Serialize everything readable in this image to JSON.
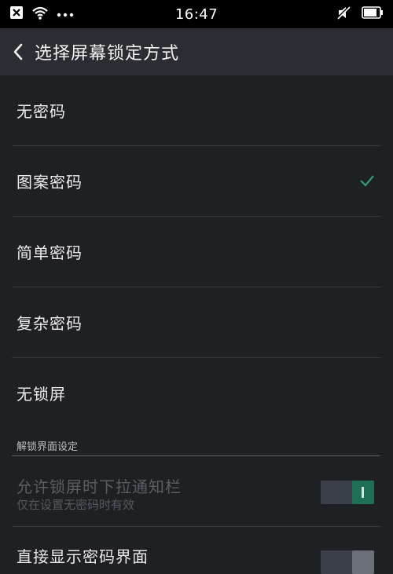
{
  "status_bar": {
    "time": "16:47",
    "left_icons": [
      "close-box-icon",
      "wifi-icon",
      "more-dots-icon"
    ],
    "right_icons": [
      "muted-speaker-icon",
      "battery-icon"
    ]
  },
  "app_bar": {
    "title": "选择屏幕锁定方式"
  },
  "lock_options": [
    {
      "label": "无密码",
      "selected": false
    },
    {
      "label": "图案密码",
      "selected": true
    },
    {
      "label": "简单密码",
      "selected": false
    },
    {
      "label": "复杂密码",
      "selected": false
    },
    {
      "label": "无锁屏",
      "selected": false
    }
  ],
  "unlock_section": {
    "header": "解锁界面设定",
    "items": [
      {
        "title": "允许锁屏时下拉通知栏",
        "subtitle": "仅在设置无密码时有效",
        "enabled": false,
        "on": true
      },
      {
        "title": "直接显示密码界面",
        "enabled": true,
        "on": false
      }
    ]
  },
  "colors": {
    "accent": "#1e7058",
    "background": "#1f2024",
    "app_bar": "#2b2d33"
  }
}
